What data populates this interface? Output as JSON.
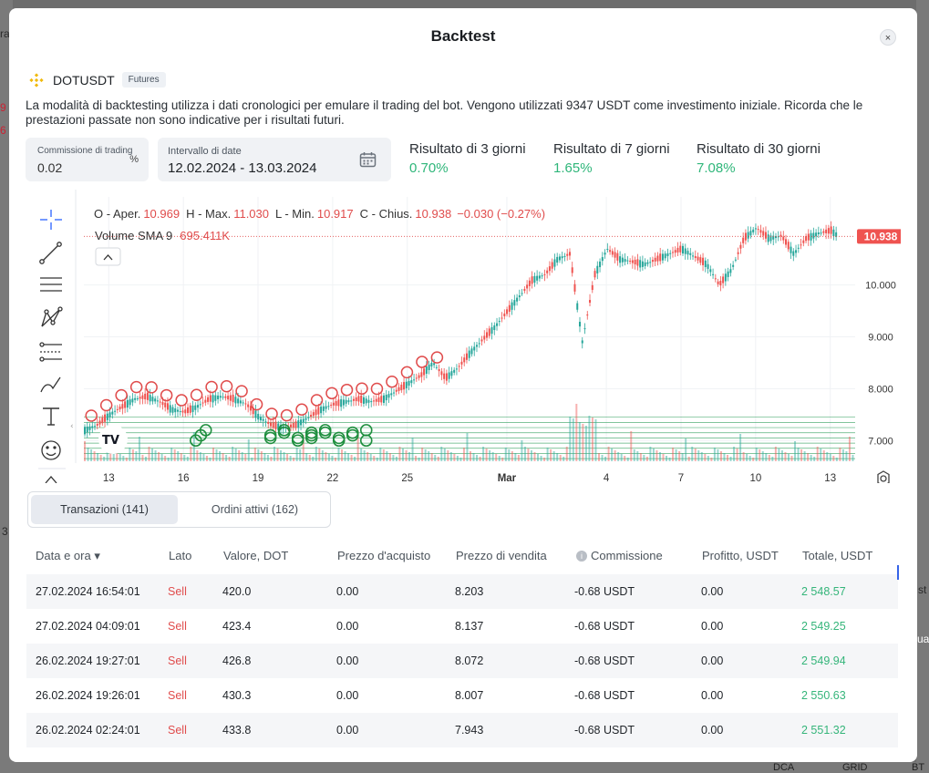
{
  "modal": {
    "title": "Backtest",
    "close_label": "×"
  },
  "pair": {
    "symbol": "DOTUSDT",
    "badge": "Futures"
  },
  "description": "La modalità di backtesting utilizza i dati cronologici per emulare il trading del bot. Vengono utilizzati 9347 USDT come investimento iniziale. Ricorda che le prestazioni passate non sono indicative per i risultati futuri.",
  "fee": {
    "label": "Commissione di trading",
    "value": "0.02",
    "unit": "%"
  },
  "dates": {
    "label": "Intervallo di date",
    "value": "12.02.2024 - 13.03.2024"
  },
  "results": [
    {
      "label": "Risultato di 3 giorni",
      "value": "0.70%"
    },
    {
      "label": "Risultato di 7 giorni",
      "value": "1.65%"
    },
    {
      "label": "Risultato di 30 giorni",
      "value": "7.08%"
    }
  ],
  "chart_data": {
    "type": "line",
    "ohlc": {
      "open_label": "O - Aper.",
      "open": "10.969",
      "high_label": "H - Max.",
      "high": "11.030",
      "low_label": "L - Min.",
      "low": "10.917",
      "close_label": "C - Chius.",
      "close": "10.938",
      "change": "−0.030 (−0.27%)"
    },
    "volume_label": "Volume SMA 9",
    "volume_value": "695.411K",
    "last_price_label": "10.938",
    "ylim": [
      6.6,
      11.7
    ],
    "yticks": [
      "10.000",
      "9.000",
      "8.000",
      "7.000"
    ],
    "ytick_values": [
      10,
      9,
      8,
      7
    ],
    "xticks": [
      "13",
      "16",
      "19",
      "22",
      "25",
      "Mar",
      "4",
      "7",
      "10",
      "13"
    ],
    "xtick_days": [
      1,
      4,
      7,
      10,
      13,
      17,
      21,
      24,
      27,
      30
    ],
    "xlim_days": [
      0,
      31
    ],
    "series": [
      {
        "x": [
          0,
          0.5,
          1,
          1.5,
          2,
          2.5,
          3,
          3.5,
          4,
          4.5,
          5,
          5.5,
          6,
          6.5,
          7,
          7.5,
          8,
          8.5,
          9,
          9.5,
          10,
          10.5,
          11,
          11.5,
          12,
          12.5,
          13,
          13.5,
          14,
          14.5,
          15,
          15.5,
          16,
          16.5,
          17,
          17.5,
          18,
          18.5,
          19,
          19.5,
          20,
          20.5,
          21,
          21.5,
          22,
          22.5,
          23,
          23.5,
          24,
          24.5,
          25,
          25.5,
          26,
          26.5,
          27,
          27.5,
          28,
          28.5,
          29,
          29.5,
          30,
          30.3
        ],
        "y": [
          7.2,
          7.3,
          7.5,
          7.65,
          7.8,
          7.85,
          7.75,
          7.6,
          7.55,
          7.65,
          7.8,
          7.85,
          7.8,
          7.7,
          7.45,
          7.3,
          7.25,
          7.3,
          7.45,
          7.6,
          7.7,
          7.75,
          7.8,
          7.75,
          7.8,
          7.95,
          8.1,
          8.25,
          8.5,
          8.2,
          8.4,
          8.7,
          8.95,
          9.2,
          9.5,
          9.8,
          10.1,
          10.2,
          10.5,
          10.6,
          8.9,
          10.2,
          10.7,
          10.5,
          10.45,
          10.4,
          10.5,
          10.6,
          10.7,
          10.55,
          10.4,
          10.0,
          10.3,
          10.9,
          11.1,
          10.9,
          10.95,
          10.6,
          10.9,
          11.0,
          11.05,
          10.938
        ]
      }
    ],
    "buy_marker_count": 20,
    "sell_marker_count": 24
  },
  "tabs": [
    {
      "label": "Transazioni (141)",
      "active": true
    },
    {
      "label": "Ordini attivi (162)",
      "active": false
    }
  ],
  "table": {
    "headers": [
      "Data e ora ▾",
      "Lato",
      "Valore, DOT",
      "Prezzo d'acquisto",
      "Prezzo di vendita",
      "Commissione",
      "Profitto, USDT",
      "Totale, USDT"
    ],
    "rows": [
      [
        "27.02.2024 16:54:01",
        "Sell",
        "420.0",
        "0.00",
        "8.203",
        "-0.68 USDT",
        "0.00",
        "2 548.57"
      ],
      [
        "27.02.2024 04:09:01",
        "Sell",
        "423.4",
        "0.00",
        "8.137",
        "-0.68 USDT",
        "0.00",
        "2 549.25"
      ],
      [
        "26.02.2024 19:27:01",
        "Sell",
        "426.8",
        "0.00",
        "8.072",
        "-0.68 USDT",
        "0.00",
        "2 549.94"
      ],
      [
        "26.02.2024 19:26:01",
        "Sell",
        "430.3",
        "0.00",
        "8.007",
        "-0.68 USDT",
        "0.00",
        "2 550.63"
      ],
      [
        "26.02.2024 02:24:01",
        "Sell",
        "433.8",
        "0.00",
        "7.943",
        "-0.68 USDT",
        "0.00",
        "2 551.32"
      ]
    ]
  },
  "background": {
    "left_fragments": [
      "ra",
      "9",
      "6",
      "3"
    ],
    "right_fragments": [
      "st",
      "ua"
    ],
    "bottom_labels": [
      "DCA",
      "GRID",
      "BT"
    ]
  },
  "colors": {
    "up": "#26a69a",
    "down": "#ef5350",
    "buy_marker": "#1e8e3e",
    "sell_marker": "#e04c4c",
    "accent_green": "#2fb67a"
  }
}
